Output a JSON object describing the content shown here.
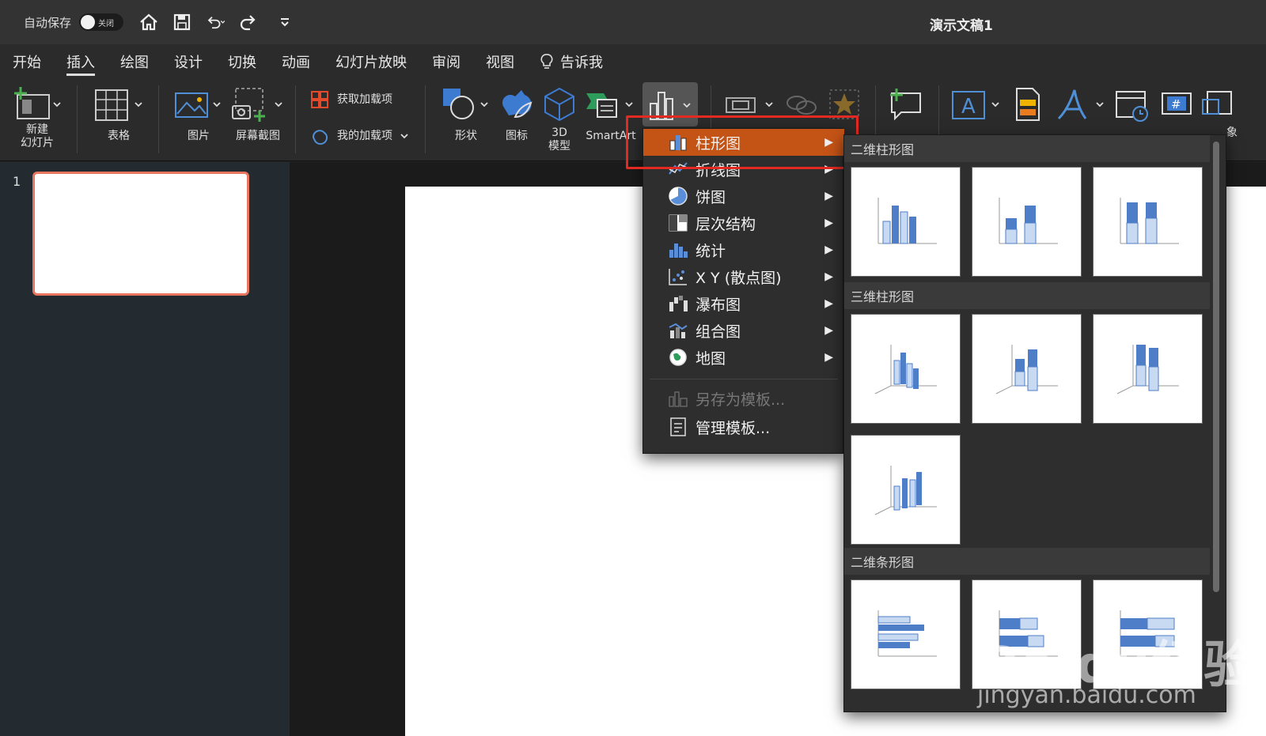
{
  "titlebar": {
    "autosave_label": "自动保存",
    "toggle_label": "关闭",
    "doc_title": "演示文稿1",
    "icons": [
      "home-icon",
      "save-icon",
      "undo-icon",
      "redo-icon",
      "customize-icon"
    ]
  },
  "menubar": {
    "tabs": [
      {
        "label": "开始"
      },
      {
        "label": "插入",
        "active": true
      },
      {
        "label": "绘图"
      },
      {
        "label": "设计"
      },
      {
        "label": "切换"
      },
      {
        "label": "动画"
      },
      {
        "label": "幻灯片放映"
      },
      {
        "label": "审阅"
      },
      {
        "label": "视图"
      },
      {
        "label": "告诉我"
      }
    ]
  },
  "ribbon": {
    "new_slide": "新建\n幻灯片",
    "table": "表格",
    "picture": "图片",
    "screenshot": "屏幕截图",
    "get_addins": "获取加载项",
    "my_addins": "我的加载项",
    "shapes": "形状",
    "icons": "图标",
    "model3d": "3D\n模型",
    "smartart": "SmartArt",
    "partial_label": "象"
  },
  "sidebar": {
    "slide_number": "1"
  },
  "chart_menu": {
    "items": [
      {
        "label": "柱形图",
        "icon": "column-chart-icon",
        "submenu": true,
        "selected": true
      },
      {
        "label": "折线图",
        "icon": "line-chart-icon",
        "submenu": true
      },
      {
        "label": "饼图",
        "icon": "pie-chart-icon",
        "submenu": true
      },
      {
        "label": "层次结构",
        "icon": "treemap-icon",
        "submenu": true
      },
      {
        "label": "统计",
        "icon": "statistic-chart-icon",
        "submenu": true
      },
      {
        "label": "X Y (散点图)",
        "icon": "scatter-chart-icon",
        "submenu": true
      },
      {
        "label": "瀑布图",
        "icon": "waterfall-chart-icon",
        "submenu": true
      },
      {
        "label": "组合图",
        "icon": "combo-chart-icon",
        "submenu": true
      },
      {
        "label": "地图",
        "icon": "map-chart-icon",
        "submenu": true
      }
    ],
    "save_template": "另存为模板...",
    "manage_template": "管理模板..."
  },
  "gallery": {
    "sections": [
      {
        "title": "二维柱形图"
      },
      {
        "title": "三维柱形图"
      },
      {
        "title": "二维条形图"
      }
    ]
  },
  "watermark": {
    "line1": "Baidu经验",
    "line2": "jingyan.baidu.com"
  },
  "colors": {
    "selected_menu": "#c45316",
    "highlight_box": "#e32a22",
    "thumbnail_border": "#e9755f",
    "chart_blue": "#4f7ec8",
    "chart_light_blue": "#c8daf2"
  }
}
